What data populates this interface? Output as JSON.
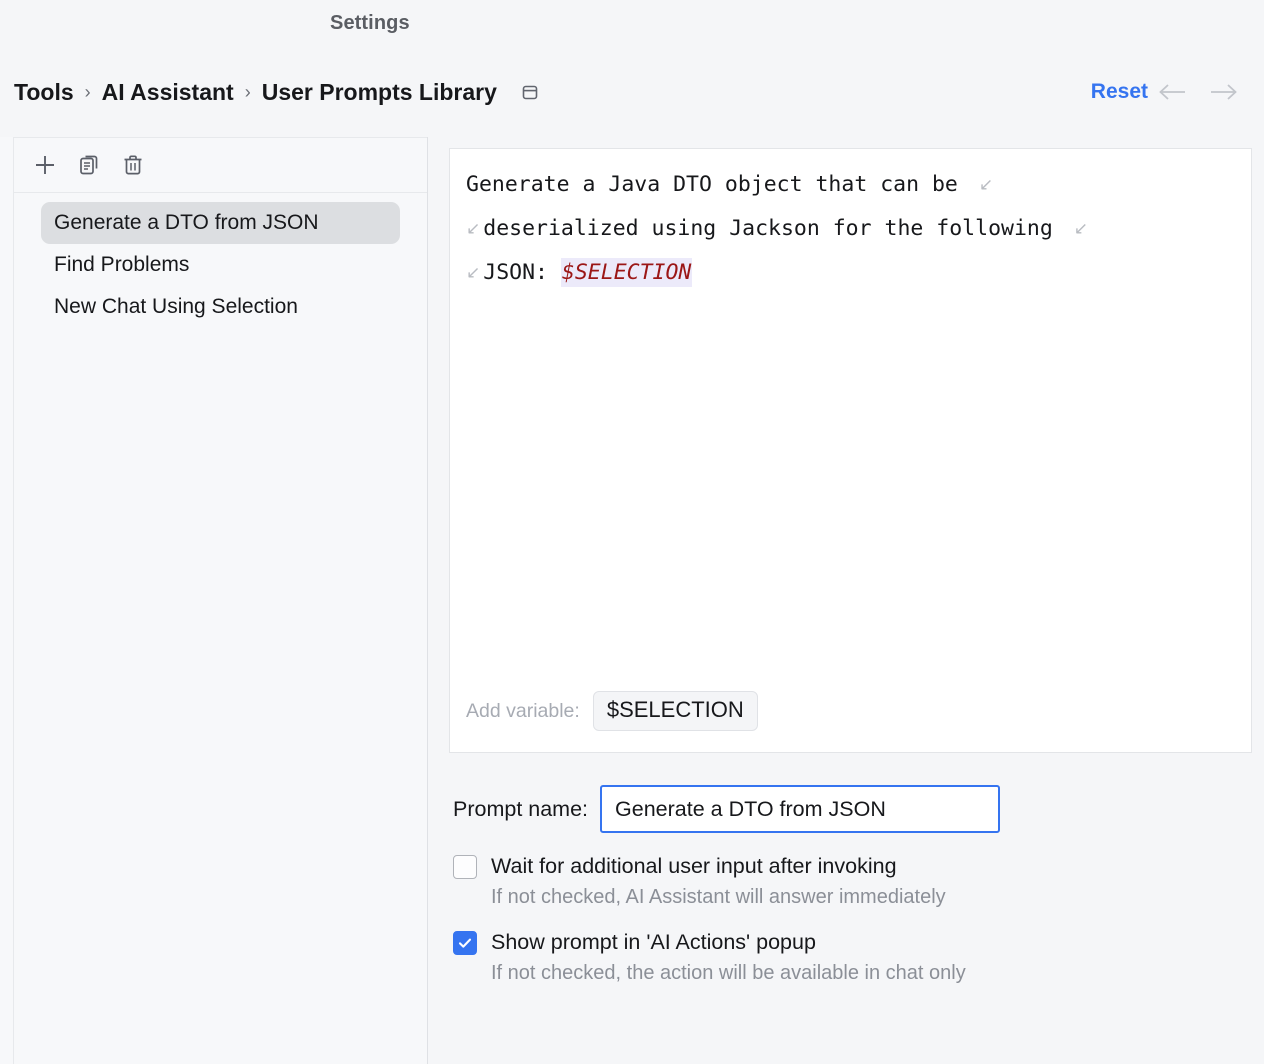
{
  "window": {
    "title": "Settings"
  },
  "header": {
    "breadcrumbs": [
      "Tools",
      "AI Assistant",
      "User Prompts Library"
    ],
    "separator": "›",
    "panel_icon": "panel-window-icon",
    "reset_label": "Reset",
    "back_icon": "arrow-left-icon",
    "forward_icon": "arrow-right-icon",
    "accent_color": "#3574f0"
  },
  "sidebar": {
    "toolbar": [
      {
        "name": "add-prompt-button",
        "icon": "plus-icon"
      },
      {
        "name": "duplicate-prompt-button",
        "icon": "copy-icon"
      },
      {
        "name": "delete-prompt-button",
        "icon": "trash-icon"
      }
    ],
    "items": [
      {
        "label": "Generate a DTO from JSON",
        "selected": true
      },
      {
        "label": "Find Problems",
        "selected": false
      },
      {
        "label": "New Chat Using Selection",
        "selected": false
      }
    ],
    "selected_bg": "#dcdee1"
  },
  "editor": {
    "lines": [
      {
        "lead_wrap": false,
        "text": "Generate a Java DTO object that can be ",
        "trail_wrap": true
      },
      {
        "lead_wrap": true,
        "text": "deserialized using Jackson for the following ",
        "trail_wrap": true
      },
      {
        "lead_wrap": true,
        "text": "JSON: ",
        "variable": "$SELECTION",
        "trail_wrap": false
      }
    ],
    "wrap_glyph": "↙",
    "variable_color": "#9b1616",
    "variable_bg": "#eceafa",
    "add_variable_label": "Add variable:",
    "variable_chip": "$SELECTION"
  },
  "form": {
    "prompt_name_label": "Prompt name:",
    "prompt_name_value": "Generate a DTO from JSON",
    "prompt_name_placeholder": "Prompt name",
    "checkboxes": [
      {
        "label": "Wait for additional user input after invoking",
        "hint": "If not checked, AI Assistant will answer immediately",
        "checked": false
      },
      {
        "label": "Show prompt in 'AI Actions' popup",
        "hint": "If not checked, the action will be available in chat only",
        "checked": true
      }
    ]
  }
}
